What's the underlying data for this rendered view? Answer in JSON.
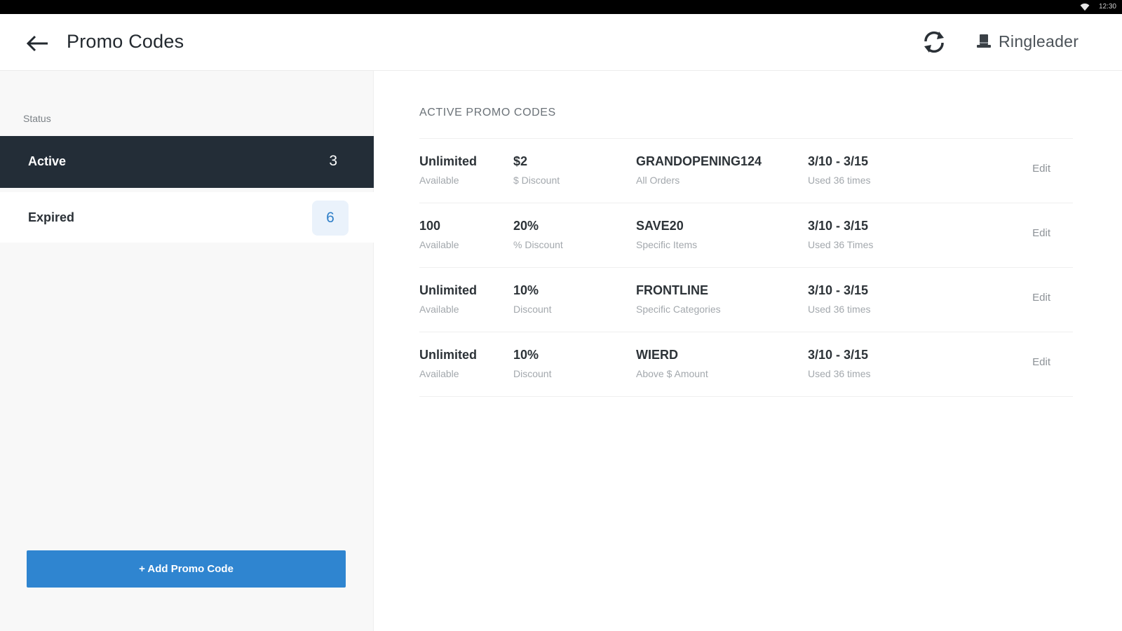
{
  "status_bar": {
    "time": "12:30",
    "wifi_icon": "wifi-icon"
  },
  "header": {
    "title": "Promo Codes",
    "back_icon": "arrow-left-icon",
    "refresh_icon": "refresh-icon",
    "brand_icon": "top-hat-icon",
    "brand_name": "Ringleader"
  },
  "sidebar": {
    "status_label": "Status",
    "filters": [
      {
        "label": "Active",
        "count": "3"
      },
      {
        "label": "Expired",
        "count": "6"
      }
    ],
    "add_button": "+ Add Promo Code"
  },
  "main": {
    "section_title": "ACTIVE PROMO CODES",
    "edit_label": "Edit",
    "rows": [
      {
        "quantity": "Unlimited",
        "quantity_sub": "Available",
        "amount": "$2",
        "amount_sub": "$ Discount",
        "code": "GRANDOPENING124",
        "code_sub": "All Orders",
        "dates": "3/10 - 3/15",
        "usage": "Used 36 times"
      },
      {
        "quantity": "100",
        "quantity_sub": "Available",
        "amount": "20%",
        "amount_sub": "% Discount",
        "code": "SAVE20",
        "code_sub": "Specific Items",
        "dates": "3/10 - 3/15",
        "usage": "Used 36 Times"
      },
      {
        "quantity": "Unlimited",
        "quantity_sub": "Available",
        "amount": "10%",
        "amount_sub": "Discount",
        "code": "FRONTLINE",
        "code_sub": "Specific Categories",
        "dates": "3/10 - 3/15",
        "usage": "Used 36 times"
      },
      {
        "quantity": "Unlimited",
        "quantity_sub": "Available",
        "amount": "10%",
        "amount_sub": "Discount",
        "code": "WIERD",
        "code_sub": "Above $ Amount",
        "dates": "3/10 - 3/15",
        "usage": "Used 36 times"
      }
    ]
  },
  "colors": {
    "active_filter_bg": "#232d37",
    "accent": "#2f85d0",
    "badge_bg": "#eaf2fb"
  }
}
